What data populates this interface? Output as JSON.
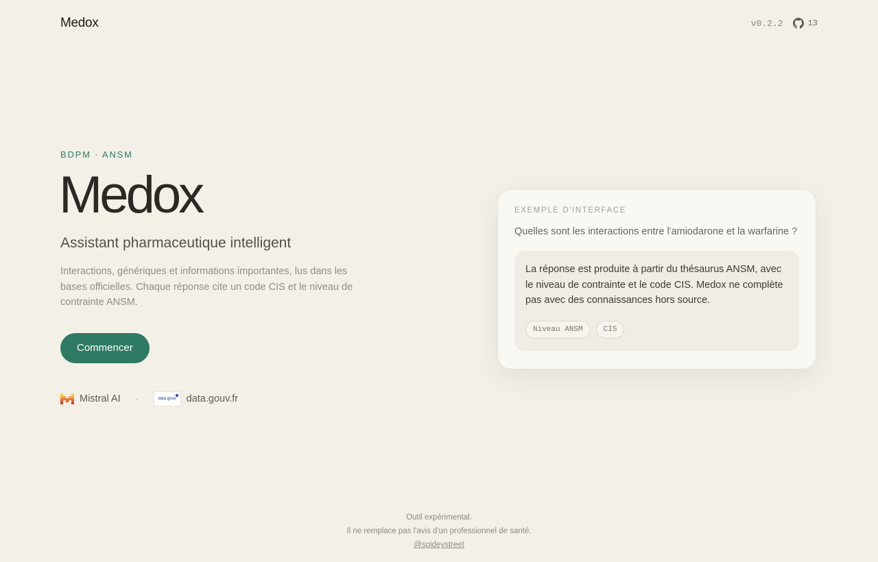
{
  "header": {
    "brand": "Medox",
    "version": "v0.2.2",
    "github_icon": "github-icon",
    "github_stars": "13"
  },
  "hero": {
    "eyebrow": "BDPM · ANSM",
    "title": "Medox",
    "subtitle": "Assistant pharmaceutique intelligent",
    "description": "Interactions, génériques et informations importantes, lus dans les bases officielles. Chaque réponse cite un code CIS et le niveau de contrainte ANSM.",
    "cta_label": "Commencer"
  },
  "partners": [
    {
      "name": "Mistral AI",
      "icon": "mistral-logo"
    },
    {
      "separator": "·"
    },
    {
      "name": "data.gouv.fr",
      "icon": "datagouv-logo",
      "logo_text": "data.gouv"
    }
  ],
  "example_card": {
    "eyebrow": "EXEMPLE D'INTERFACE",
    "question": "Quelles sont les interactions entre l'amiodarone et la warfarine ?",
    "answer": "La réponse est produite à partir du thésaurus ANSM, avec le niveau de contrainte et le code CIS. Medox ne complète pas avec des connaissances hors source.",
    "tags": [
      "Niveau ANSM",
      "CIS"
    ]
  },
  "footer": {
    "line1": "Outil expérimental.",
    "line2": "Il ne remplace pas l'avis d'un professionnel de santé.",
    "link": "@spideystreet"
  },
  "colors": {
    "background": "#f3f0e8",
    "accent": "#2e7a64",
    "card": "#faf8f3"
  }
}
